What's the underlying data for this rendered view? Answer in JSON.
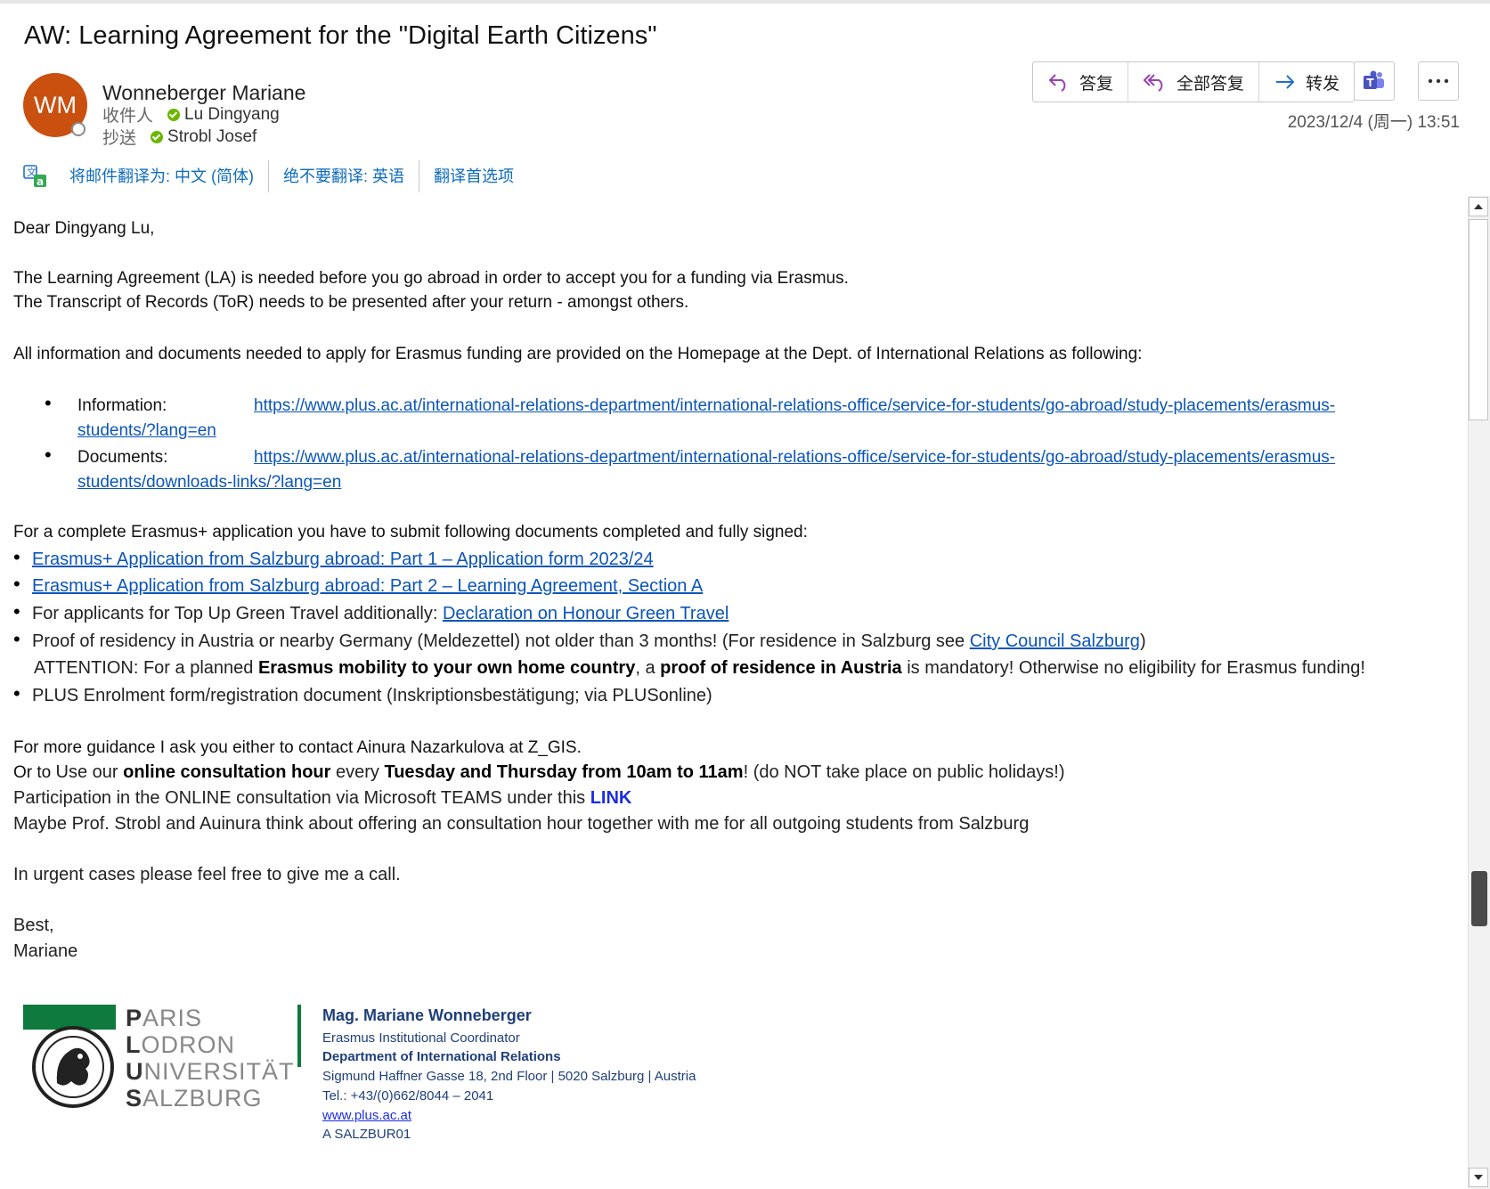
{
  "email": {
    "subject": "AW: Learning Agreement for the \"Digital Earth Citizens\"",
    "avatar_initials": "WM",
    "sender_name": "Wonneberger Mariane",
    "to_label": "收件人",
    "to_name": "Lu Dingyang",
    "cc_label": "抄送",
    "cc_name": "Strobl Josef",
    "date": "2023/12/4 (周一) 13:51",
    "colors": {
      "avatar": "#ca5010",
      "presence_ok": "#6bb700",
      "link": "#0b55b8"
    }
  },
  "actions": {
    "reply": "答复",
    "reply_all": "全部答复",
    "forward": "转发",
    "teams_icon": "teams-icon",
    "more_icon": "more-icon"
  },
  "translation_bar": {
    "translate": "将邮件翻译为: 中文 (简体)",
    "never": "绝不要翻译: 英语",
    "prefs": "翻译首选项"
  },
  "body": {
    "greeting": "Dear Dingyang Lu,",
    "p1_l1": "The Learning Agreement (LA) is needed before you go abroad in order to accept you for a funding via Erasmus.",
    "p1_l2": "The Transcript of Records (ToR) needs to be presented after your return - amongst others.",
    "p2": "All information and documents needed to apply for Erasmus funding are provided on the Homepage at the Dept. of International Relations  as following:",
    "info_label": "Information:",
    "info_url_1": "https://www.plus.ac.at/international-relations-department/international-relations-office/service-for-students/go-abroad/study-placements/erasmus-",
    "info_url_2": "students/?lang=en",
    "docs_label": "Documents:",
    "docs_url_1": "https://www.plus.ac.at/international-relations-department/international-relations-office/service-for-students/go-abroad/study-placements/erasmus-",
    "docs_url_2": "students/downloads-links/?lang=en",
    "p3": "For a complete Erasmus+ application you have to submit following documents completed and fully signed:",
    "doc1": "Erasmus+ Application from Salzburg abroad: Part 1 – Application form 2023/24",
    "doc2": "Erasmus+ Application from Salzburg abroad: Part 2 – Learning Agreement, Section A",
    "doc3_pre": "For applicants for Top Up Green Travel additionally: ",
    "doc3_link": "Declaration on Honour Green Travel",
    "doc4_pre": "Proof of residency in Austria or nearby Germany (Meldezettel) not older than 3 months! (For residence in Salzburg see   ",
    "doc4_link": "City Council Salzburg",
    "doc4_post": ")",
    "att_1": "ATTENTION: For a planned ",
    "att_b1": "Erasmus mobility to your own home country",
    "att_2": ", a ",
    "att_b2": "proof of residence in Austria",
    "att_3": " is mandatory! Otherwise no eligibility for Erasmus funding!",
    "doc5": "PLUS Enrolment form/registration document (Inskriptionsbestätigung; via PLUSonline)",
    "g1": "For more guidance I ask you either to contact Ainura Nazarkulova at Z_GIS.",
    "g2_a": "Or to ",
    "g2_b": "Use our ",
    "g2_bold1": "online consultation hour",
    "g2_c": " every ",
    "g2_bold2": "Tuesday and Thursday from 10am to 11am",
    "g2_d": "! (do NOT take place on public holidays!)",
    "g3_pre": "Participation in the ONLINE consultation via Microsoft TEAMS under this ",
    "g3_link": "LINK",
    "g4": "Maybe Prof. Strobl and Auinura think about offering an consultation hour together with me for all outgoing students from Salzburg",
    "urgent": "In urgent cases please feel free to give me a call.",
    "best": "Best,",
    "name": "Mariane"
  },
  "signature": {
    "logo_l1_first": "P",
    "logo_l1_rest": "ARIS",
    "logo_l2_first": "L",
    "logo_l2_rest": "ODRON",
    "logo_l3_first": "U",
    "logo_l3_rest": "NIVERSITÄT",
    "logo_l4_first": "S",
    "logo_l4_rest": "ALZBURG",
    "name": "Mag. Mariane Wonneberger",
    "role": "Erasmus Institutional Coordinator",
    "dept": "Department of International Relations",
    "address": "Sigmund Haffner Gasse 18, 2nd Floor | 5020 Salzburg | Austria",
    "tel": "Tel.: +43/(0)662/8044 – 2041",
    "web": "www.plus.ac.at",
    "code": "A SALZBUR01"
  }
}
